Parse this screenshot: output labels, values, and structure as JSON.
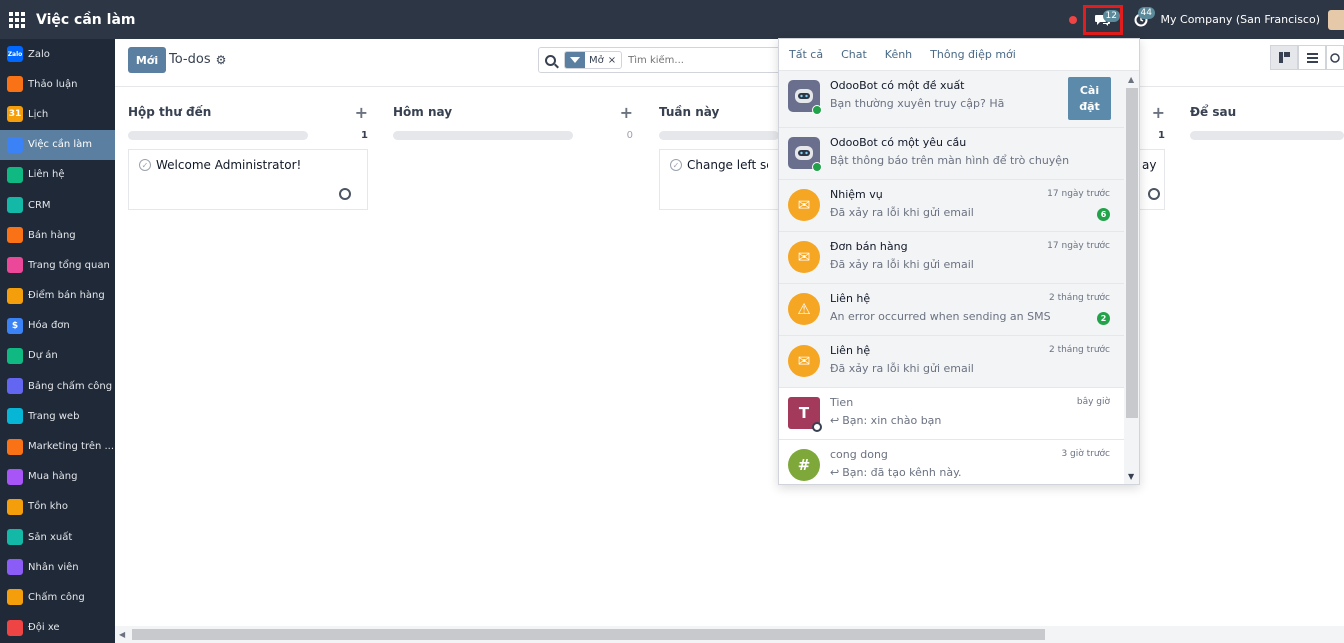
{
  "topbar": {
    "app_title": "Việc cần làm",
    "messages_count": "12",
    "activities_count": "44",
    "company": "My Company (San Francisco)"
  },
  "sidebar": {
    "items": [
      {
        "label": "Zalo",
        "icon": "zalo-icon",
        "color": "#0068ff",
        "glyph": "Zalo"
      },
      {
        "label": "Thảo luận",
        "icon": "discuss-icon",
        "color": "#f97316",
        "glyph": ""
      },
      {
        "label": "Lịch",
        "icon": "calendar-icon",
        "color": "#f59e0b",
        "glyph": "31"
      },
      {
        "label": "Việc cần làm",
        "icon": "todo-icon",
        "color": "#3b82f6",
        "glyph": ""
      },
      {
        "label": "Liên hệ",
        "icon": "contacts-icon",
        "color": "#10b981",
        "glyph": ""
      },
      {
        "label": "CRM",
        "icon": "crm-icon",
        "color": "#14b8a6",
        "glyph": ""
      },
      {
        "label": "Bán hàng",
        "icon": "sales-icon",
        "color": "#f97316",
        "glyph": ""
      },
      {
        "label": "Trang tổng quan",
        "icon": "dashboard-icon",
        "color": "#ec4899",
        "glyph": ""
      },
      {
        "label": "Điểm bán hàng",
        "icon": "pos-icon",
        "color": "#f59e0b",
        "glyph": ""
      },
      {
        "label": "Hóa đơn",
        "icon": "invoice-icon",
        "color": "#3b82f6",
        "glyph": "$"
      },
      {
        "label": "Dự án",
        "icon": "project-icon",
        "color": "#10b981",
        "glyph": ""
      },
      {
        "label": "Bảng chấm công",
        "icon": "timesheet-icon",
        "color": "#6366f1",
        "glyph": ""
      },
      {
        "label": "Trang web",
        "icon": "website-icon",
        "color": "#06b6d4",
        "glyph": ""
      },
      {
        "label": "Marketing trên ...",
        "icon": "marketing-icon",
        "color": "#f97316",
        "glyph": ""
      },
      {
        "label": "Mua hàng",
        "icon": "purchase-icon",
        "color": "#a855f7",
        "glyph": ""
      },
      {
        "label": "Tồn kho",
        "icon": "inventory-icon",
        "color": "#f59e0b",
        "glyph": ""
      },
      {
        "label": "Sản xuất",
        "icon": "manufacturing-icon",
        "color": "#14b8a6",
        "glyph": ""
      },
      {
        "label": "Nhân viên",
        "icon": "employees-icon",
        "color": "#8b5cf6",
        "glyph": ""
      },
      {
        "label": "Chấm công",
        "icon": "attendance-icon",
        "color": "#f59e0b",
        "glyph": ""
      },
      {
        "label": "Đội xe",
        "icon": "fleet-icon",
        "color": "#ef4444",
        "glyph": ""
      }
    ],
    "active_index": 3
  },
  "control": {
    "new_label": "Mới",
    "breadcrumb": "To-dos",
    "facet_label": "Mở",
    "search_placeholder": "Tìm kiếm..."
  },
  "kanban": {
    "columns": [
      {
        "title": "Hộp thư đến",
        "count": "1",
        "card": "Welcome Administrator!"
      },
      {
        "title": "Hôm nay",
        "count": "0",
        "card": ""
      },
      {
        "title": "Tuần này",
        "count": "",
        "card": "Change left scre"
      },
      {
        "title": "",
        "count": "1",
        "card": "ay"
      },
      {
        "title": "Để sau",
        "count": "",
        "card": ""
      }
    ]
  },
  "dropdown": {
    "tabs": [
      "Tất cả",
      "Chat",
      "Kênh",
      "Thông điệp mới"
    ],
    "items": [
      {
        "name": "OdooBot có một đề xuất",
        "text": "Bạn thường xuyên truy cập? Hãy cài đặt Odo...",
        "time": "",
        "count": "",
        "button": "Cài đặt"
      },
      {
        "name": "OdooBot có một yêu cầu",
        "text": "Bật thông báo trên màn hình để trò chuyện",
        "time": "",
        "count": ""
      },
      {
        "name": "Nhiệm vụ",
        "text": "Đã xảy ra lỗi khi gửi email",
        "time": "17 ngày trước",
        "count": "6"
      },
      {
        "name": "Đơn bán hàng",
        "text": "Đã xảy ra lỗi khi gửi email",
        "time": "17 ngày trước",
        "count": ""
      },
      {
        "name": "Liên hệ",
        "text": "An error occurred when sending an SMS",
        "time": "2 tháng trước",
        "count": "2"
      },
      {
        "name": "Liên hệ",
        "text": "Đã xảy ra lỗi khi gửi email",
        "time": "2 tháng trước",
        "count": ""
      },
      {
        "name": "Tien",
        "text": "Bạn: xin chào bạn",
        "time": "bây giờ",
        "count": "",
        "avatar_letter": "T"
      },
      {
        "name": "cong dong",
        "text": "Bạn: đã tạo kênh này.",
        "time": "3 giờ trước",
        "count": "",
        "avatar_letter": "#"
      }
    ]
  }
}
